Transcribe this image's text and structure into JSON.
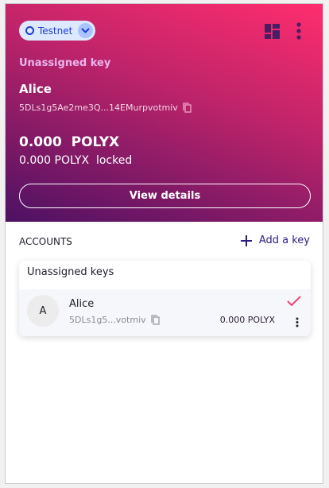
{
  "network": {
    "label": "Testnet"
  },
  "header": {
    "key_type": "Unassigned key",
    "name": "Alice",
    "address": "5DLs1g5Ae2me3Q...14EMurpvotmiv",
    "balance": "0.000  POLYX",
    "locked": "0.000 POLYX  locked",
    "view_details": "View details"
  },
  "accounts": {
    "title": "ACCOUNTS",
    "add_label": "Add a key",
    "group_title": "Unassigned keys",
    "items": [
      {
        "initial": "A",
        "name": "Alice",
        "address": "5DLs1g5...votmiv",
        "balance": "0.000 POLYX"
      }
    ]
  },
  "colors": {
    "accent": "#ec4673",
    "brand_dark": "#4d1163",
    "network": "#1f3bd6"
  }
}
